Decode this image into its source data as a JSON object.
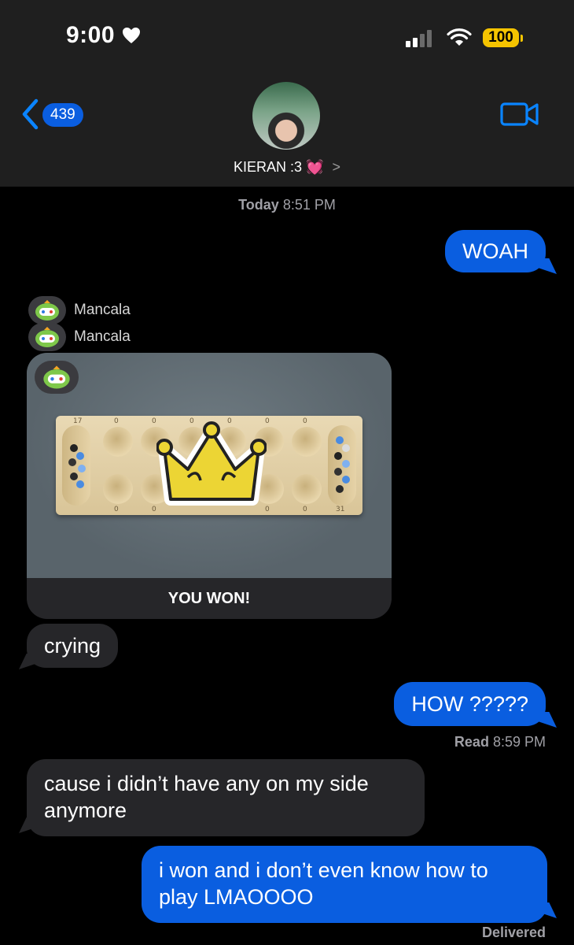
{
  "status_bar": {
    "time": "9:00",
    "battery": "100"
  },
  "header": {
    "back_count": "439",
    "contact_name": "KIERAN :3 💓",
    "chevron": ">"
  },
  "thread": {
    "timestamp_day": "Today",
    "timestamp_time": "8:51 PM",
    "msg_woah": "WOAH",
    "game_sender_1": "Mancala",
    "game_sender_2": "Mancala",
    "game_caption": "YOU WON!",
    "board_numbers": [
      "17",
      "0",
      "0",
      "0",
      "0",
      "0",
      "0",
      "0",
      "0",
      "0",
      "0",
      "31"
    ],
    "msg_crying": "crying",
    "msg_how": "HOW ?????",
    "read_label": "Read",
    "read_time": "8:59 PM",
    "msg_cause_line1": "cause i didn’t have any on my side",
    "msg_cause_line2": "anymore",
    "msg_won_line1": "i won and i don’t even know how to",
    "msg_won_line2": "play LMAOOOO",
    "delivered": "Delivered"
  },
  "colors": {
    "sent": "#0a5ee0",
    "received": "#262629",
    "header": "#1f1f1f",
    "battery": "#f5c400",
    "crown": "#ecd534"
  },
  "icons": [
    "heart-icon",
    "signal-icon",
    "wifi-icon",
    "back-chevron-icon",
    "video-call-icon",
    "mancala-app-icon",
    "crown-icon"
  ]
}
